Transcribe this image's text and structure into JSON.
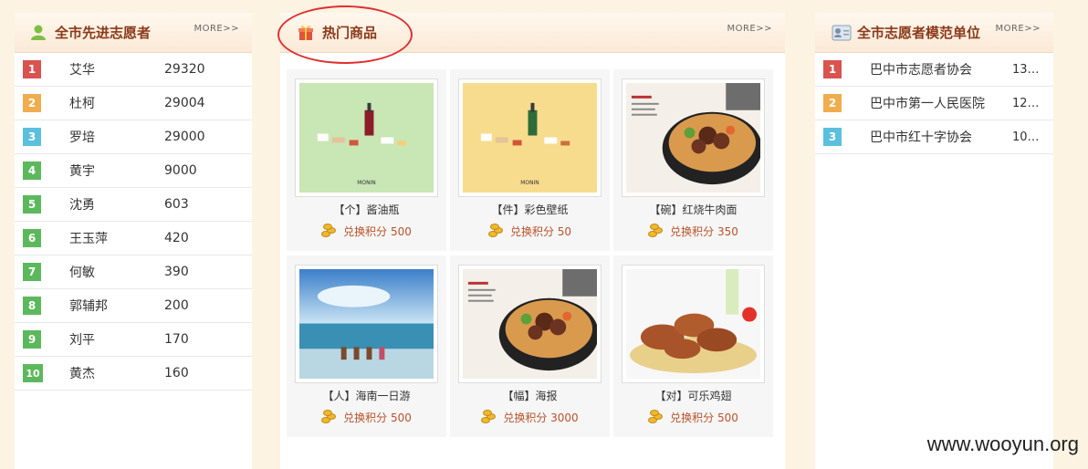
{
  "left": {
    "title": "全市先进志愿者",
    "more": "MORE>>",
    "items": [
      {
        "rank": "1",
        "name": "艾华",
        "score": "29320",
        "color": "#d9534f"
      },
      {
        "rank": "2",
        "name": "杜柯",
        "score": "29004",
        "color": "#f0ad4e"
      },
      {
        "rank": "3",
        "name": "罗培",
        "score": "29000",
        "color": "#5bc0de"
      },
      {
        "rank": "4",
        "name": "黄宇",
        "score": "9000",
        "color": "#5cb85c"
      },
      {
        "rank": "5",
        "name": "沈勇",
        "score": "603",
        "color": "#5cb85c"
      },
      {
        "rank": "6",
        "name": "王玉萍",
        "score": "420",
        "color": "#5cb85c"
      },
      {
        "rank": "7",
        "name": "何敏",
        "score": "390",
        "color": "#5cb85c"
      },
      {
        "rank": "8",
        "name": "郭辅邦",
        "score": "200",
        "color": "#5cb85c"
      },
      {
        "rank": "9",
        "name": "刘平",
        "score": "170",
        "color": "#5cb85c"
      },
      {
        "rank": "10",
        "name": "黄杰",
        "score": "160",
        "color": "#5cb85c"
      }
    ]
  },
  "center": {
    "title": "热门商品",
    "more": "MORE>>",
    "goods": [
      {
        "name": "【个】酱油瓶",
        "price": "兑换积分 500",
        "image": "soy-sauce-bottle-green"
      },
      {
        "name": "【件】彩色壁纸",
        "price": "兑换积分 50",
        "image": "color-wallpaper-yellow"
      },
      {
        "name": "【碗】红烧牛肉面",
        "price": "兑换积分 350",
        "image": "beef-noodle"
      },
      {
        "name": "【人】海南一日游",
        "price": "兑换积分 500",
        "image": "hainan-beach"
      },
      {
        "name": "【幅】海报",
        "price": "兑换积分 3000",
        "image": "noodle-poster"
      },
      {
        "name": "【对】可乐鸡翅",
        "price": "兑换积分 500",
        "image": "cola-chicken-wings"
      }
    ]
  },
  "right": {
    "title": "全市志愿者模范单位",
    "more": "MORE>>",
    "items": [
      {
        "rank": "1",
        "name": "巴中市志愿者协会",
        "score": "13…",
        "color": "#d9534f"
      },
      {
        "rank": "2",
        "name": "巴中市第一人民医院",
        "score": "12…",
        "color": "#f0ad4e"
      },
      {
        "rank": "3",
        "name": "巴中市红十字协会",
        "score": "10…",
        "color": "#5bc0de"
      }
    ]
  },
  "watermark": "www.wooyun.org",
  "colors": {
    "title": "#8a3a1a",
    "price": "#b8522a",
    "annotation": "#e03030"
  }
}
